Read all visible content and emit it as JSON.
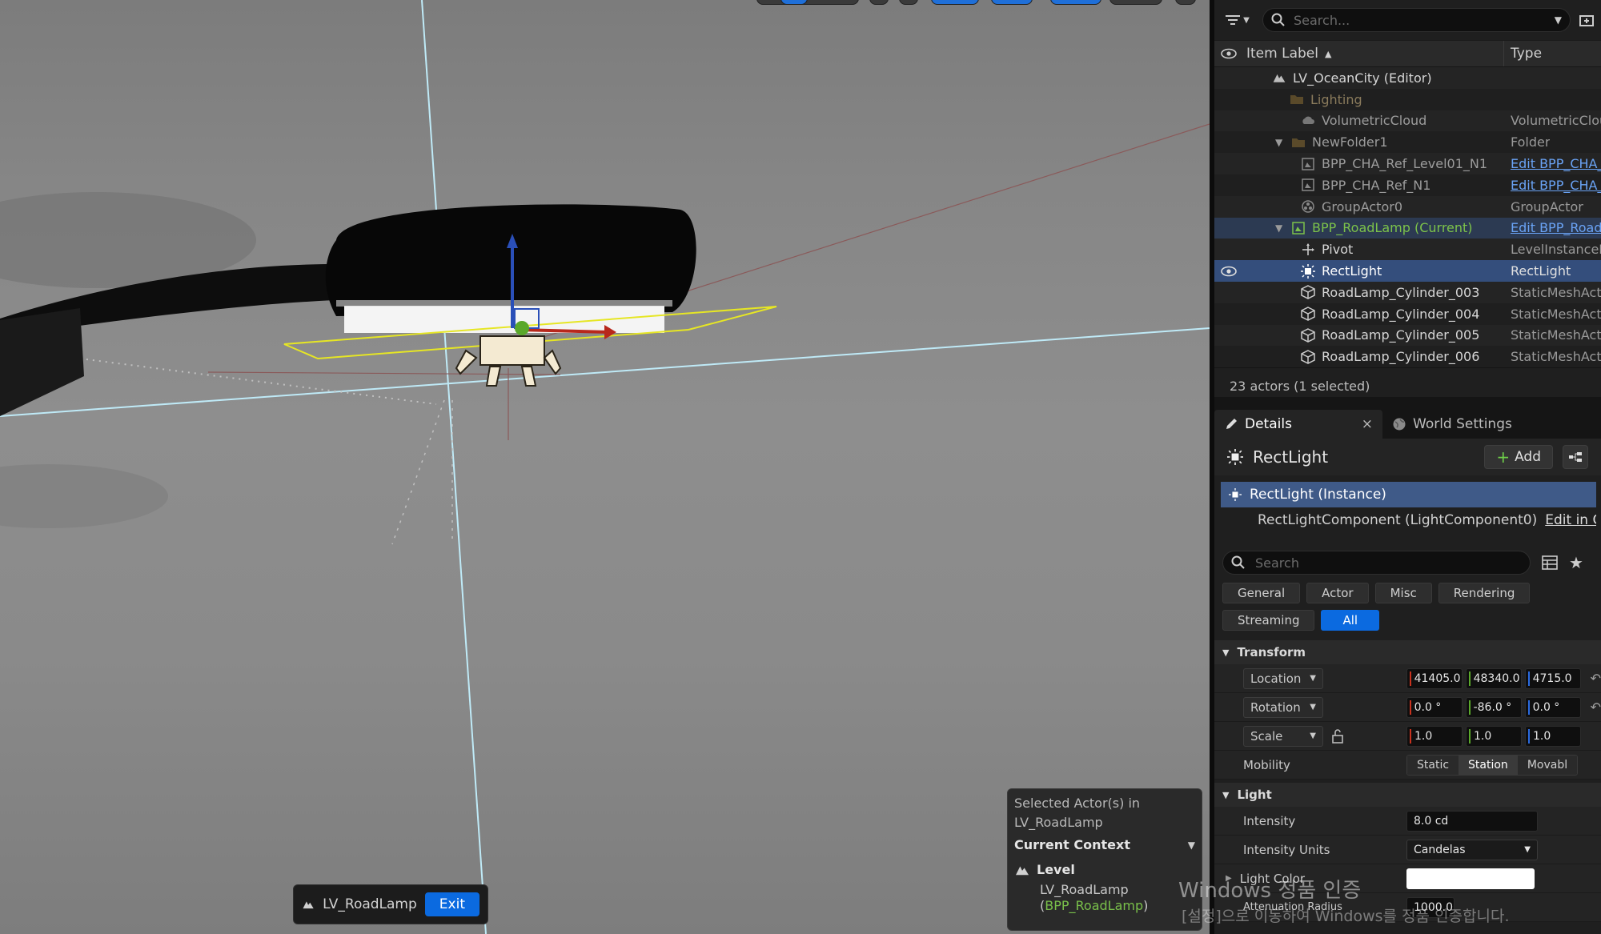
{
  "viewport": {
    "level_chip": {
      "label": "LV_RoadLamp",
      "exit_label": "Exit"
    },
    "selected_panel": {
      "title_line1": "Selected Actor(s) in",
      "title_line2": "LV_RoadLamp",
      "context_label": "Current Context",
      "level_label": "Level",
      "level_name": "LV_RoadLamp",
      "paren_open": "(",
      "bpp_name": "BPP_RoadLamp",
      "paren_close": ")"
    },
    "watermark": {
      "line1": "Windows 정품 인증",
      "line2": "[설정]으로 이동하여 Windows를 정품 인증합니다."
    }
  },
  "outliner": {
    "search_placeholder": "Search...",
    "col_label": "Item Label",
    "col_sort": "▲",
    "col_type": "Type",
    "rows": [
      {
        "label": "LV_OceanCity (Editor)",
        "type": ""
      },
      {
        "label": "Lighting",
        "type": ""
      },
      {
        "label": "VolumetricCloud",
        "type": "VolumetricCloud"
      },
      {
        "label": "NewFolder1",
        "type": "Folder"
      },
      {
        "label": "BPP_CHA_Ref_Level01_N1",
        "type": "Edit BPP_CHA_"
      },
      {
        "label": "BPP_CHA_Ref_N1",
        "type": "Edit BPP_CHA_"
      },
      {
        "label": "GroupActor0",
        "type": "GroupActor"
      },
      {
        "label": "BPP_RoadLamp (Current)",
        "type": "Edit BPP_Road"
      },
      {
        "label": "Pivot",
        "type": "LevelInstanceP"
      },
      {
        "label": "RectLight",
        "type": "RectLight"
      },
      {
        "label": "RoadLamp_Cylinder_003",
        "type": "StaticMeshAct"
      },
      {
        "label": "RoadLamp_Cylinder_004",
        "type": "StaticMeshAct"
      },
      {
        "label": "RoadLamp_Cylinder_005",
        "type": "StaticMeshAct"
      },
      {
        "label": "RoadLamp_Cylinder_006",
        "type": "StaticMeshAct"
      }
    ],
    "status": "23 actors (1 selected)"
  },
  "details": {
    "tab_details": "Details",
    "tab_close": "×",
    "tab_world": "World Settings",
    "actor_name": "RectLight",
    "add_label": "Add",
    "instance_label": "RectLight (Instance)",
    "component_label": "RectLightComponent (LightComponent0)",
    "edit_cpp": "Edit in C++",
    "search_placeholder": "Search",
    "filters": [
      "General",
      "Actor",
      "Misc",
      "Rendering",
      "Streaming",
      "All"
    ],
    "transform": {
      "section": "Transform",
      "location_label": "Location",
      "location": [
        "41405.0",
        "48340.0",
        "4715.0"
      ],
      "rotation_label": "Rotation",
      "rotation": [
        "0.0 °",
        "-86.0 °",
        "0.0 °"
      ],
      "scale_label": "Scale",
      "scale": [
        "1.0",
        "1.0",
        "1.0"
      ],
      "mobility_label": "Mobility",
      "mobility": [
        "Static",
        "Station",
        "Movabl"
      ]
    },
    "light": {
      "section": "Light",
      "intensity_label": "Intensity",
      "intensity": "8.0 cd",
      "units_label": "Intensity Units",
      "units": "Candelas",
      "color_label": "Light Color",
      "radius_label": "Attenuation Radius",
      "radius": "1000.0"
    }
  }
}
